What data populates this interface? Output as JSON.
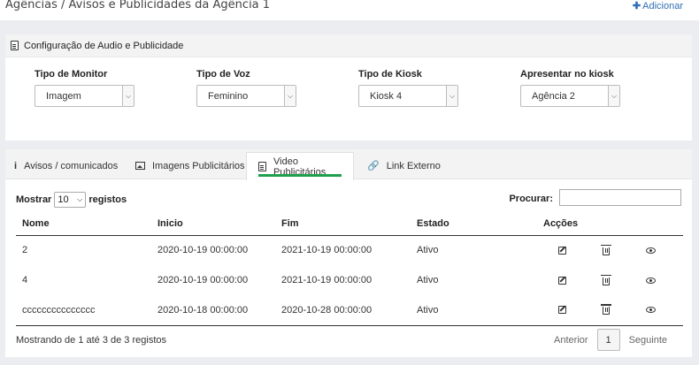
{
  "header": {
    "title": "Agências / Avisos e Publicidades da Agência 1",
    "add_label": "Adicionar"
  },
  "config": {
    "title": "Configuração de Audio e Publicidade",
    "fields": [
      {
        "label": "Tipo de Monitor",
        "value": "Imagem"
      },
      {
        "label": "Tipo de Voz",
        "value": "Feminino"
      },
      {
        "label": "Tipo de Kiosk",
        "value": "Kiosk 4"
      },
      {
        "label": "Apresentar no kiosk",
        "value": "Agência 2"
      }
    ]
  },
  "tabs": [
    {
      "label": "Avisos / comunicados",
      "icon": "info-icon"
    },
    {
      "label": "Imagens Publicitários",
      "icon": "image-icon"
    },
    {
      "label": "Video Publicitários",
      "icon": "video-file-icon",
      "active": true
    },
    {
      "label": "Link Externo",
      "icon": "link-icon"
    }
  ],
  "table_controls": {
    "show_label": "Mostrar",
    "length_value": "10",
    "records_label": "registos",
    "search_label": "Procurar:",
    "search_value": ""
  },
  "table": {
    "columns": [
      "Nome",
      "Inicio",
      "Fim",
      "Estado",
      "Acções"
    ],
    "rows": [
      {
        "nome": "2",
        "inicio": "2020-10-19 00:00:00",
        "fim": "2021-10-19 00:00:00",
        "estado": "Ativo"
      },
      {
        "nome": "4",
        "inicio": "2020-10-19 00:00:00",
        "fim": "2021-10-19 00:00:00",
        "estado": "Ativo"
      },
      {
        "nome": "ccccccccccccccc",
        "inicio": "2020-10-18 00:00:00",
        "fim": "2020-10-28 00:00:00",
        "estado": "Ativo"
      }
    ]
  },
  "footer": {
    "info": "Mostrando de 1 até 3 de 3 registos",
    "prev": "Anterior",
    "page": "1",
    "next": "Seguinte"
  },
  "colors": {
    "accent_green": "#1ea04d",
    "link_blue": "#2f6fb5",
    "background": "#ecedf0"
  }
}
